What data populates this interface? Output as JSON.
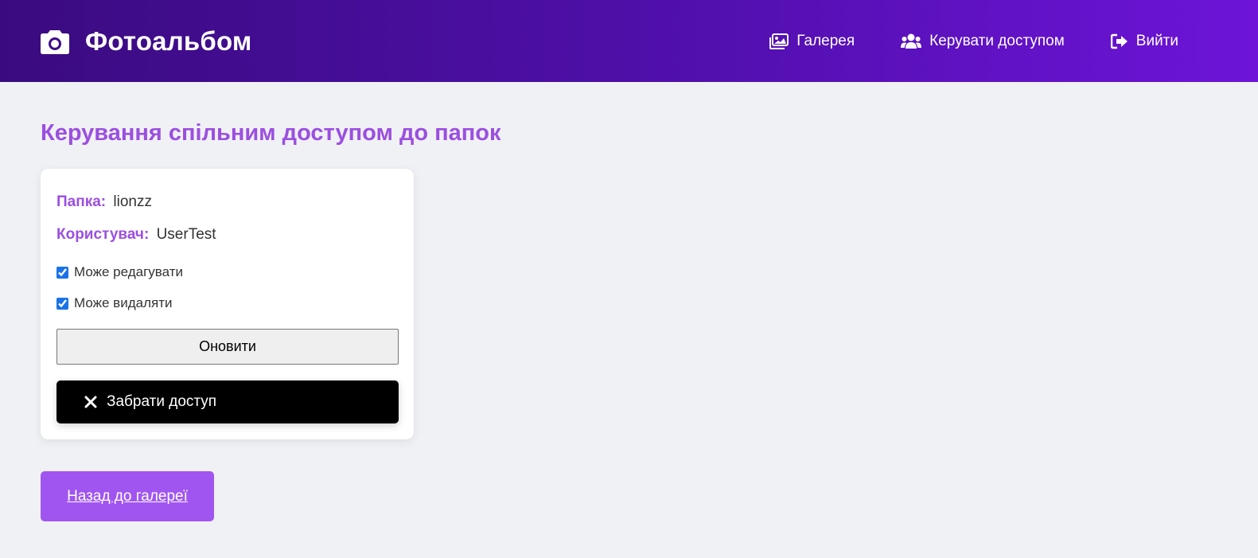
{
  "header": {
    "brand_title": "Фотоальбом",
    "brand_icon": "camera-icon",
    "nav": [
      {
        "label": "Галерея",
        "icon": "images-icon"
      },
      {
        "label": "Керувати доступом",
        "icon": "users-icon"
      },
      {
        "label": "Вийти",
        "icon": "logout-icon"
      }
    ]
  },
  "main": {
    "title": "Керування спільним доступом до папок",
    "card": {
      "folder_label": "Папка:",
      "folder_value": "lionzz",
      "user_label": "Користувач:",
      "user_value": "UserTest",
      "can_edit_label": "Може редагувати",
      "can_edit_checked": true,
      "can_delete_label": "Може видаляти",
      "can_delete_checked": true,
      "update_button": "Оновити",
      "revoke_button": "Забрати доступ",
      "revoke_icon": "close-icon"
    },
    "back_link": "Назад до галереї"
  },
  "colors": {
    "header_gradient_start": "#3a0b80",
    "header_gradient_end": "#6d14d8",
    "accent": "#9b4fe0",
    "back_button": "#a155f0",
    "background": "#f0f1f5"
  }
}
